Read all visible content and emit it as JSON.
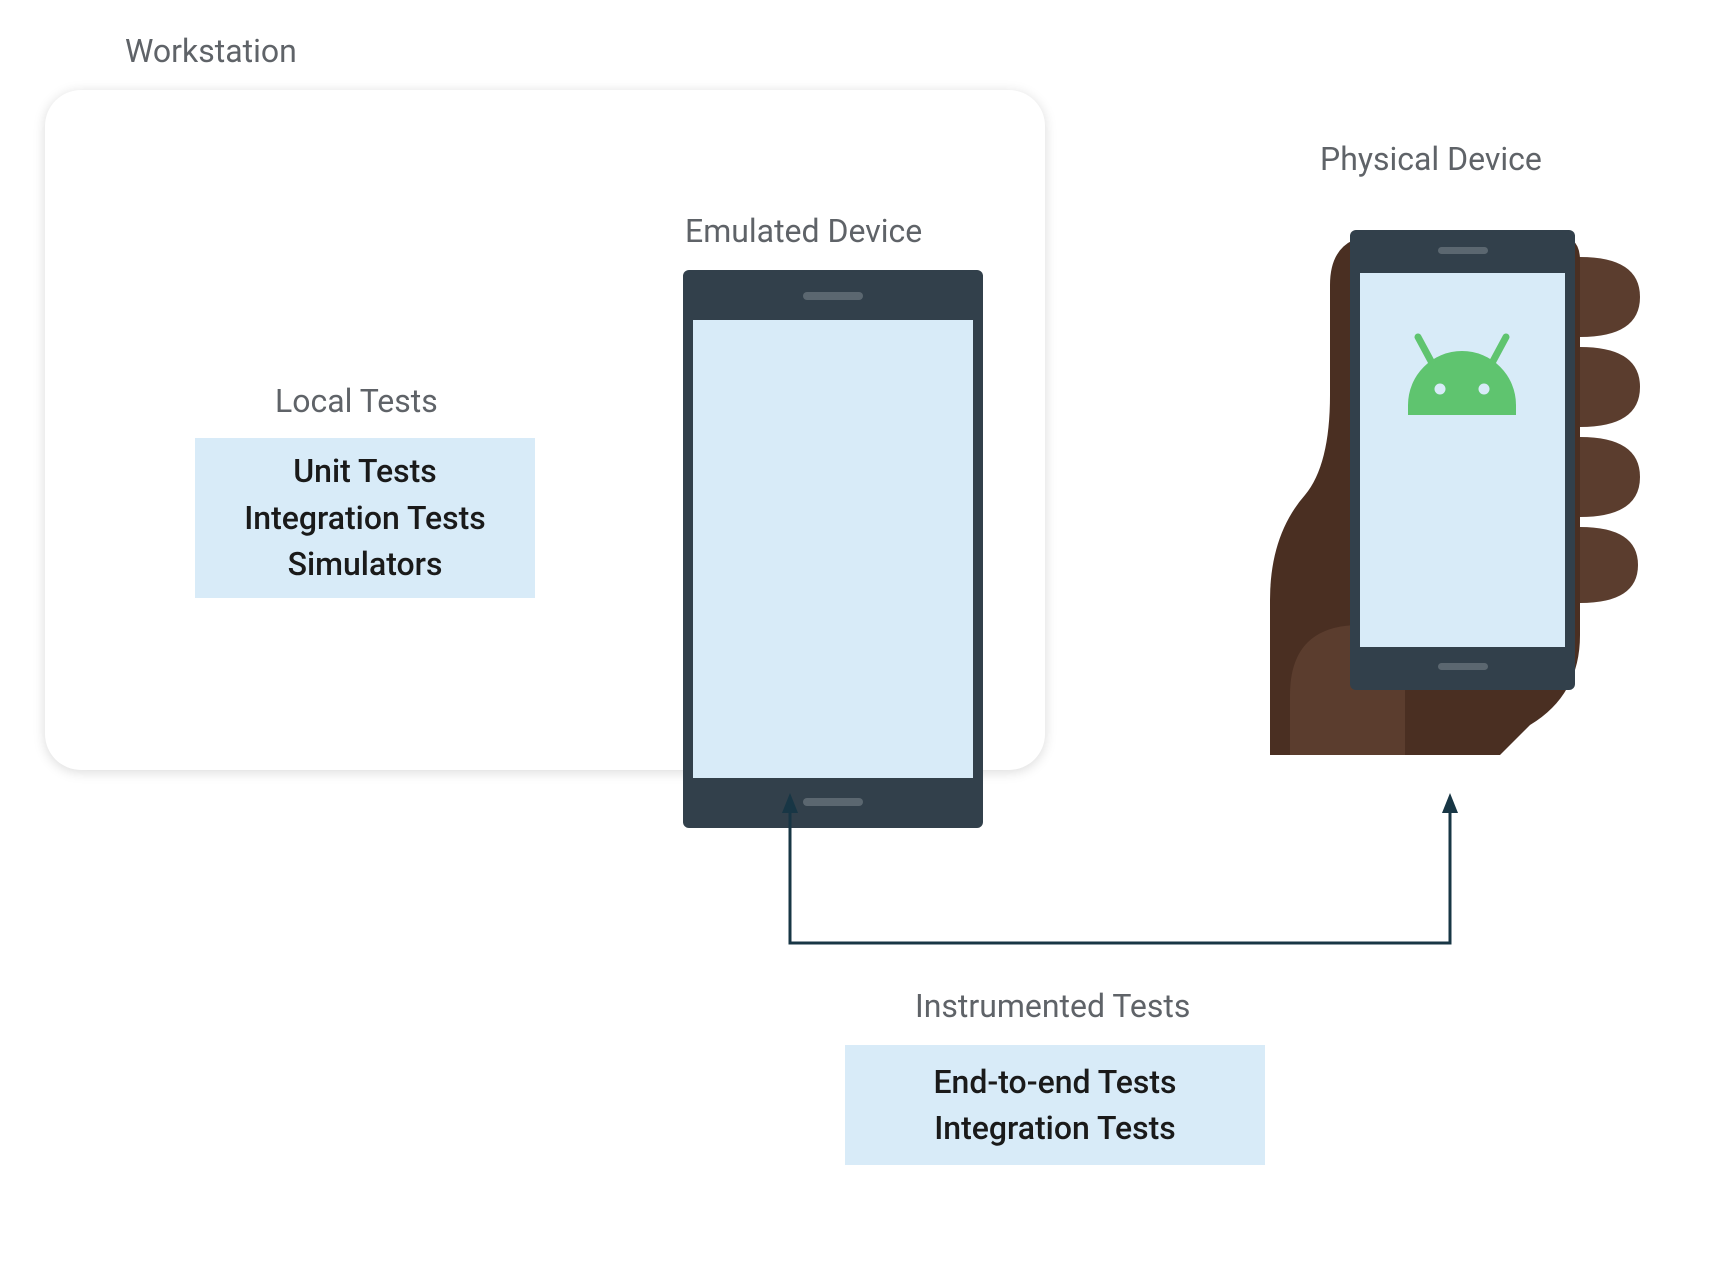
{
  "workstation": {
    "label": "Workstation",
    "local_tests": {
      "label": "Local Tests",
      "items": [
        "Unit Tests",
        "Integration Tests",
        "Simulators"
      ]
    },
    "emulated_device": {
      "label": "Emulated Device"
    }
  },
  "physical_device": {
    "label": "Physical Device"
  },
  "instrumented_tests": {
    "label": "Instrumented Tests",
    "items": [
      "End-to-end Tests",
      "Integration Tests"
    ]
  },
  "colors": {
    "card_bg": "#ffffff",
    "box_bg": "#d8ebf8",
    "text_muted": "#5f6368",
    "text_strong": "#1a1a1a",
    "device_frame": "#32404b",
    "device_screen": "#d8ebf8",
    "hand": "#5b3d2e",
    "hand_dark": "#4a2f22",
    "android_green": "#5fc46f",
    "arrow": "#183645"
  }
}
